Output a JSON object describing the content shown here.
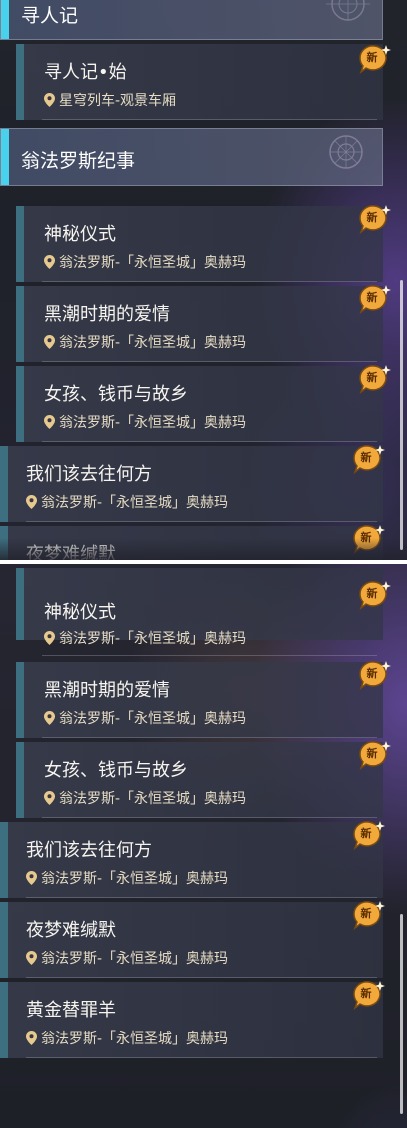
{
  "pane_top": {
    "header_partial": {
      "title": "寻人记"
    },
    "quest_xunren": {
      "title": "寻人记•始",
      "location": "星穹列车-观景车厢",
      "badge": "新"
    },
    "header_wengfa": {
      "title": "翁法罗斯纪事"
    },
    "quests": [
      {
        "title": "神秘仪式",
        "location": "翁法罗斯-「永恒圣城」奥赫玛",
        "badge": "新"
      },
      {
        "title": "黑潮时期的爱情",
        "location": "翁法罗斯-「永恒圣城」奥赫玛",
        "badge": "新"
      },
      {
        "title": "女孩、钱币与故乡",
        "location": "翁法罗斯-「永恒圣城」奥赫玛",
        "badge": "新"
      },
      {
        "title": "我们该去往何方",
        "location": "翁法罗斯-「永恒圣城」奥赫玛",
        "badge": "新"
      },
      {
        "title": "夜梦难缄默",
        "badge": "新"
      }
    ]
  },
  "pane_bottom": {
    "quests": [
      {
        "title": "神秘仪式",
        "location": "翁法罗斯-「永恒圣城」奥赫玛",
        "badge": "新"
      },
      {
        "title": "黑潮时期的爱情",
        "location": "翁法罗斯-「永恒圣城」奥赫玛",
        "badge": "新"
      },
      {
        "title": "女孩、钱币与故乡",
        "location": "翁法罗斯-「永恒圣城」奥赫玛",
        "badge": "新"
      },
      {
        "title": "我们该去往何方",
        "location": "翁法罗斯-「永恒圣城」奥赫玛",
        "badge": "新"
      },
      {
        "title": "夜梦难缄默",
        "location": "翁法罗斯-「永恒圣城」奥赫玛",
        "badge": "新"
      },
      {
        "title": "黄金替罪羊",
        "location": "翁法罗斯-「永恒圣城」奥赫玛",
        "badge": "新"
      }
    ]
  },
  "icons": {
    "location": "location-pin-icon",
    "new_badge": "new-badge-icon",
    "emblem": "emblem-icon"
  },
  "colors": {
    "accent": "#48d2ee",
    "quest_bar": "#3d6f80",
    "location_text": "#e6dcc4",
    "badge": "#f2a93b"
  }
}
